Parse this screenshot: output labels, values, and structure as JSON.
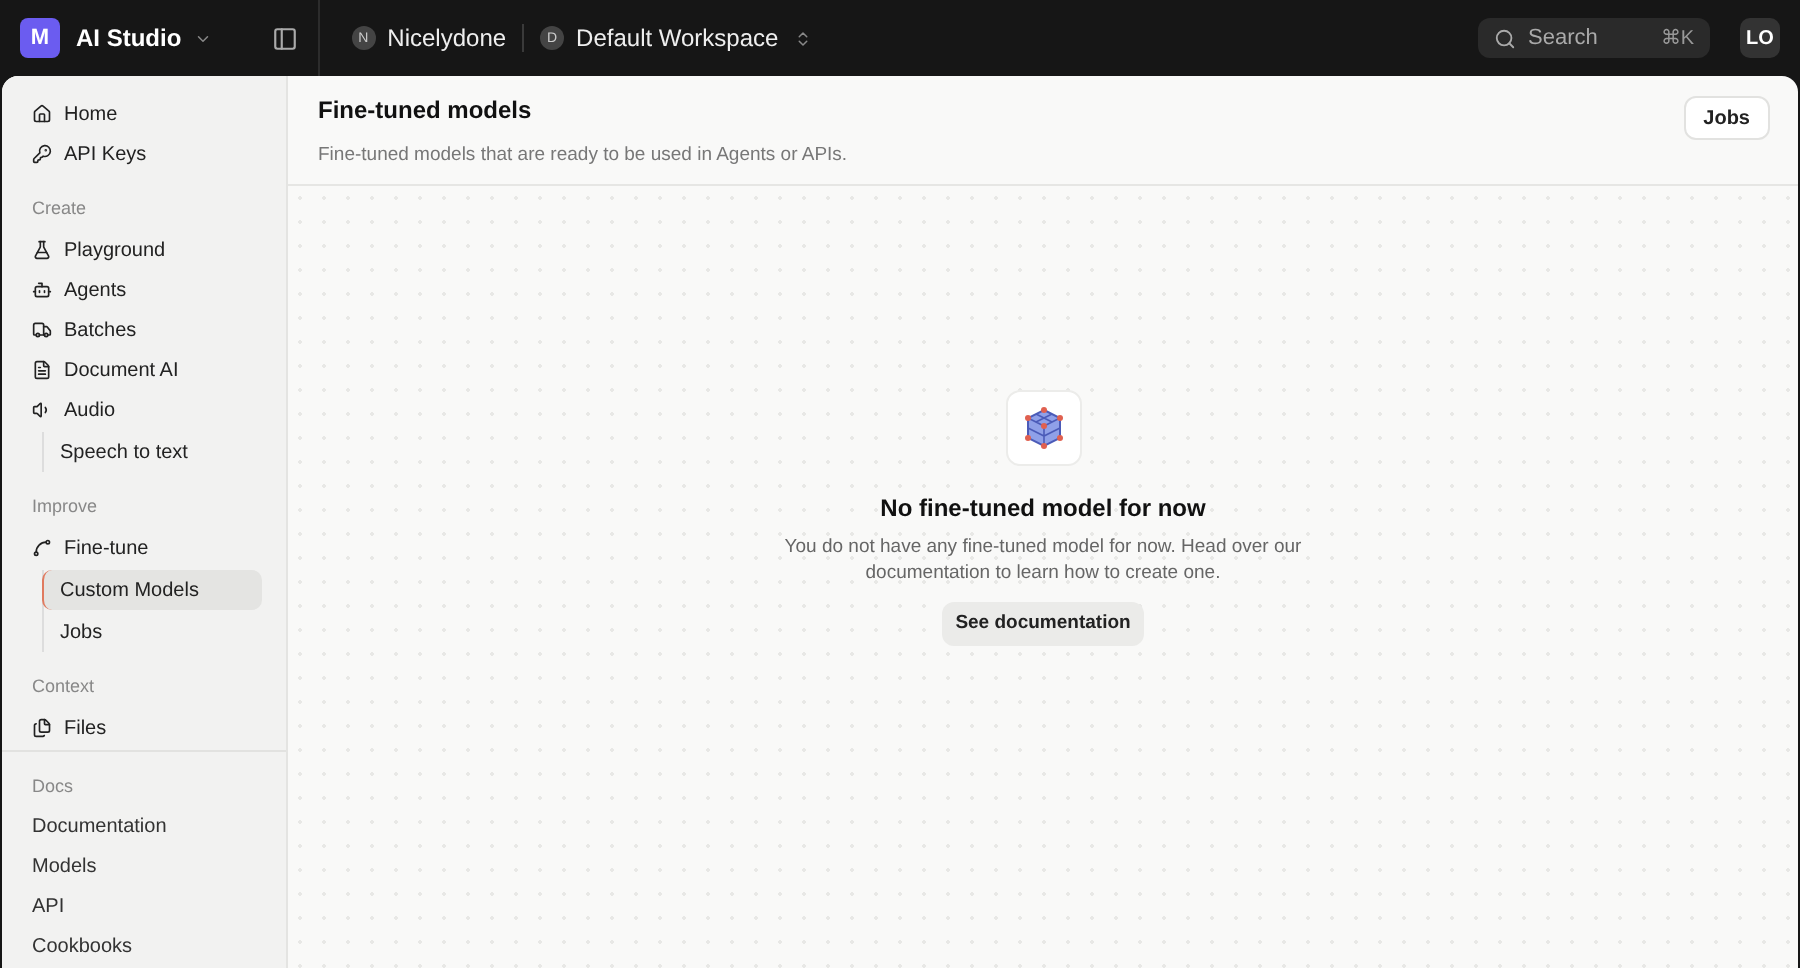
{
  "topbar": {
    "logo": "M",
    "app": "AI Studio",
    "org": {
      "initial": "N",
      "name": "Nicelydone"
    },
    "workspace": {
      "initial": "D",
      "name": "Default Workspace"
    },
    "search": {
      "placeholder": "Search",
      "shortcut": "⌘K"
    },
    "avatar": "LO"
  },
  "sidebar": {
    "sections": [
      {
        "items": [
          {
            "label": "Home"
          },
          {
            "label": "API Keys"
          }
        ]
      },
      {
        "heading": "Create",
        "items": [
          {
            "label": "Playground"
          },
          {
            "label": "Agents"
          },
          {
            "label": "Batches"
          },
          {
            "label": "Document AI"
          },
          {
            "label": "Audio",
            "children": [
              {
                "label": "Speech to text",
                "selected": false
              }
            ]
          }
        ]
      },
      {
        "heading": "Improve",
        "items": [
          {
            "label": "Fine-tune",
            "children": [
              {
                "label": "Custom Models",
                "selected": true
              },
              {
                "label": "Jobs",
                "selected": false
              }
            ]
          }
        ]
      },
      {
        "heading": "Context",
        "items": [
          {
            "label": "Files"
          }
        ]
      }
    ],
    "docs": {
      "heading": "Docs",
      "links": [
        "Documentation",
        "Models",
        "API",
        "Cookbooks"
      ]
    }
  },
  "main": {
    "title": "Fine-tuned models",
    "subtitle": "Fine-tuned models that are ready to be used in Agents or APIs.",
    "action": "Jobs",
    "empty": {
      "title": "No fine-tuned model for now",
      "text": "You do not have any fine-tuned model for now. Head over our documentation to learn how to create one.",
      "button": "See documentation"
    }
  }
}
